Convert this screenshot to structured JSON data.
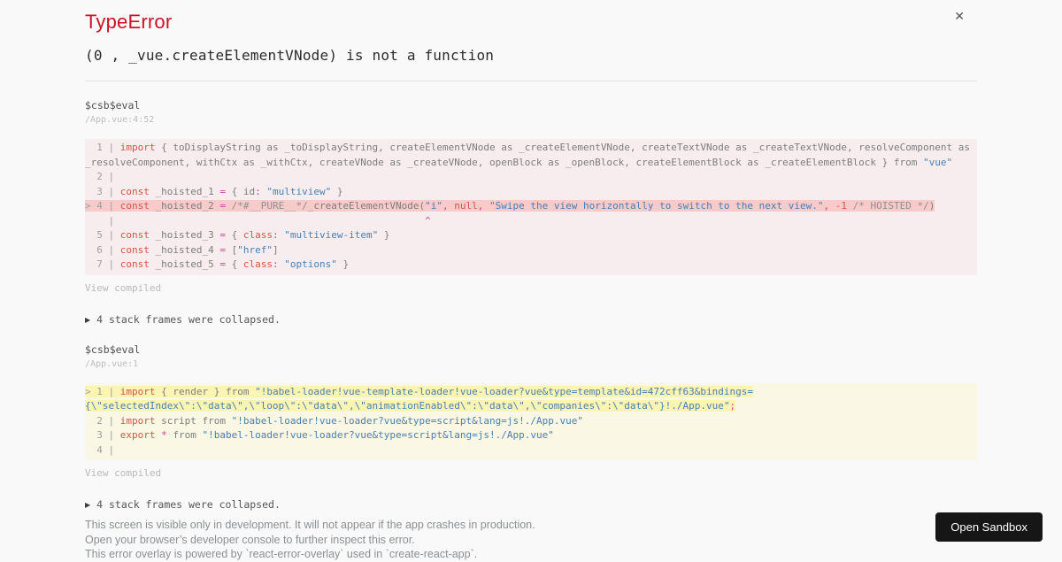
{
  "colors": {
    "page_background": "#f9f9f9",
    "title_red": "#ce1126",
    "code_block_red_bg": "rgba(206,17,38,0.05)",
    "code_highlight_red": "#f8caca",
    "code_block_yellow_bg": "rgba(251,245,180,0.3)",
    "code_highlight_yellow": "#fbf5b4",
    "string_blue": "#477fb3",
    "keyword_red": "#d65348",
    "operator_magenta": "#cf3f9f",
    "button_dark": "#161616"
  },
  "icons": {
    "close": "✕",
    "expand_triangle": "▶"
  },
  "header": {
    "title": "TypeError",
    "message": "(0 , _vue.createElementVNode) is not a function"
  },
  "frames": [
    {
      "function": "$csb$eval",
      "location": "/App.vue:4:52",
      "view_compiled_label": "View compiled",
      "collapsed_label": "4 stack frames were collapsed.",
      "lines": [
        {
          "tokens": [
            {
              "c": "g",
              "t": "  1 | "
            },
            {
              "c": "k",
              "t": "import"
            },
            {
              "c": "p",
              "t": " { toDisplayString as _toDisplayString, createElementVNode as _createElementVNode, createTextVNode as _createTextVNode, resolveComponent as"
            }
          ]
        },
        {
          "tokens": [
            {
              "c": "p",
              "t": "_resolveComponent, withCtx as _withCtx, createVNode as _createVNode, openBlock as _openBlock, createElementBlock as _createElementBlock } from "
            },
            {
              "c": "s",
              "t": "\"vue\""
            }
          ]
        },
        {
          "tokens": [
            {
              "c": "g",
              "t": "  2 | "
            }
          ]
        },
        {
          "tokens": [
            {
              "c": "g",
              "t": "  3 | "
            },
            {
              "c": "k",
              "t": "const"
            },
            {
              "c": "p",
              "t": " _hoisted_1 "
            },
            {
              "c": "o",
              "t": "="
            },
            {
              "c": "p",
              "t": " { id"
            },
            {
              "c": "o",
              "t": ":"
            },
            {
              "c": "p",
              "t": " "
            },
            {
              "c": "s",
              "t": "\"multiview\""
            },
            {
              "c": "p",
              "t": " }"
            }
          ]
        },
        {
          "hl": true,
          "tokens": [
            {
              "c": "g",
              "t": "> 4 | "
            },
            {
              "c": "k",
              "t": "const"
            },
            {
              "c": "p",
              "t": " _hoisted_2 "
            },
            {
              "c": "o",
              "t": "="
            },
            {
              "c": "p",
              "t": " "
            },
            {
              "c": "c",
              "t": "/*#__PURE__*/"
            },
            {
              "c": "p",
              "t": "_createElementVNode("
            },
            {
              "c": "s",
              "t": "\"i\""
            },
            {
              "c": "o",
              "t": ","
            },
            {
              "c": "p",
              "t": " "
            },
            {
              "c": "k",
              "t": "null"
            },
            {
              "c": "o",
              "t": ","
            },
            {
              "c": "p",
              "t": " "
            },
            {
              "c": "s",
              "t": "\"Swipe the view horizontally to switch to the next view.\""
            },
            {
              "c": "o",
              "t": ","
            },
            {
              "c": "p",
              "t": " "
            },
            {
              "c": "n",
              "t": "-1"
            },
            {
              "c": "p",
              "t": " "
            },
            {
              "c": "c",
              "t": "/* HOISTED */"
            },
            {
              "c": "p",
              "t": ")"
            }
          ]
        },
        {
          "tokens": [
            {
              "c": "g",
              "t": "    | "
            },
            {
              "c": "p",
              "t": "                                                    "
            },
            {
              "c": "x",
              "t": "^"
            }
          ]
        },
        {
          "tokens": [
            {
              "c": "g",
              "t": "  5 | "
            },
            {
              "c": "k",
              "t": "const"
            },
            {
              "c": "p",
              "t": " _hoisted_3 "
            },
            {
              "c": "o",
              "t": "="
            },
            {
              "c": "p",
              "t": " { "
            },
            {
              "c": "k",
              "t": "class"
            },
            {
              "c": "o",
              "t": ":"
            },
            {
              "c": "p",
              "t": " "
            },
            {
              "c": "s",
              "t": "\"multiview-item\""
            },
            {
              "c": "p",
              "t": " }"
            }
          ]
        },
        {
          "tokens": [
            {
              "c": "g",
              "t": "  6 | "
            },
            {
              "c": "k",
              "t": "const"
            },
            {
              "c": "p",
              "t": " _hoisted_4 "
            },
            {
              "c": "o",
              "t": "="
            },
            {
              "c": "p",
              "t": " ["
            },
            {
              "c": "s",
              "t": "\"href\""
            },
            {
              "c": "p",
              "t": "]"
            }
          ]
        },
        {
          "tokens": [
            {
              "c": "g",
              "t": "  7 | "
            },
            {
              "c": "k",
              "t": "const"
            },
            {
              "c": "p",
              "t": " _hoisted_5 "
            },
            {
              "c": "o",
              "t": "="
            },
            {
              "c": "p",
              "t": " { "
            },
            {
              "c": "k",
              "t": "class"
            },
            {
              "c": "o",
              "t": ":"
            },
            {
              "c": "p",
              "t": " "
            },
            {
              "c": "s",
              "t": "\"options\""
            },
            {
              "c": "p",
              "t": " }"
            }
          ]
        }
      ]
    },
    {
      "function": "$csb$eval",
      "location": "/App.vue:1",
      "view_compiled_label": "View compiled",
      "collapsed_label": "4 stack frames were collapsed.",
      "lines": [
        {
          "hl": true,
          "tokens": [
            {
              "c": "g",
              "t": "> 1 | "
            },
            {
              "c": "k",
              "t": "import"
            },
            {
              "c": "p",
              "t": " { render } from "
            },
            {
              "c": "s",
              "t": "\"!babel-loader!vue-template-loader!vue-loader?vue&type=template&id=472cff63&bindings="
            }
          ]
        },
        {
          "hl": true,
          "tokens": [
            {
              "c": "s",
              "t": "{\\\"selectedIndex\\\":\\\"data\\\",\\\"loop\\\":\\\"data\\\",\\\"animationEnabled\\\":\\\"data\\\",\\\"companies\\\":\\\"data\\\"}!./App.vue\""
            },
            {
              "c": "o",
              "t": ";"
            }
          ]
        },
        {
          "tokens": [
            {
              "c": "g",
              "t": "  2 | "
            },
            {
              "c": "k",
              "t": "import"
            },
            {
              "c": "p",
              "t": " script from "
            },
            {
              "c": "s",
              "t": "\"!babel-loader!vue-loader?vue&type=script&lang=js!./App.vue\""
            }
          ]
        },
        {
          "tokens": [
            {
              "c": "g",
              "t": "  3 | "
            },
            {
              "c": "k",
              "t": "export"
            },
            {
              "c": "p",
              "t": " "
            },
            {
              "c": "o",
              "t": "*"
            },
            {
              "c": "p",
              "t": " from "
            },
            {
              "c": "s",
              "t": "\"!babel-loader!vue-loader?vue&type=script&lang=js!./App.vue\""
            }
          ]
        },
        {
          "tokens": [
            {
              "c": "g",
              "t": "  4 | "
            }
          ]
        }
      ]
    }
  ],
  "footer": {
    "notes": [
      "This screen is visible only in development. It will not appear if the app crashes in production.",
      "Open your browser’s developer console to further inspect this error.",
      "This error overlay is powered by `react-error-overlay` used in `create-react-app`."
    ],
    "open_sandbox_label": "Open Sandbox"
  }
}
